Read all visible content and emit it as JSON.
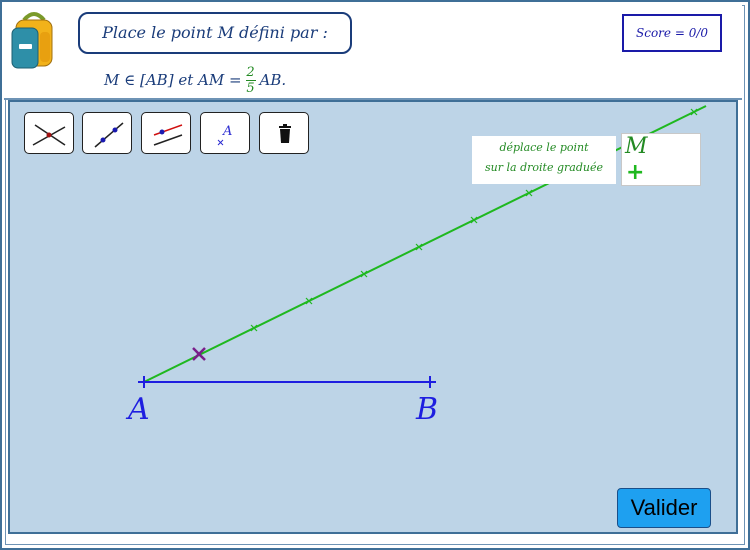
{
  "header": {
    "instruction": "Place le point M défini par :",
    "formula": {
      "prefix": "M ∈ [AB] et AM =",
      "numerator": "2",
      "denominator": "5",
      "suffix": "AB."
    },
    "score": "Score = 0/0"
  },
  "toolbar": {
    "tools": [
      {
        "name": "intersection-tool-icon"
      },
      {
        "name": "point-on-line-tool-icon"
      },
      {
        "name": "parallel-line-tool-icon"
      },
      {
        "name": "named-point-tool-icon",
        "label": "A"
      },
      {
        "name": "trash-icon"
      }
    ]
  },
  "hint": {
    "line1": "déplace le point",
    "line2": "sur la droite graduée"
  },
  "draggable_point": {
    "label": "M",
    "handle": "+"
  },
  "figure": {
    "point_a": "A",
    "point_b": "B",
    "graduation_count": 10
  },
  "colors": {
    "segment": "#1e1ee0",
    "graduated_line": "#1fb81f",
    "marked_point": "#7a1f8a",
    "accent_text": "#238a23",
    "button": "#1ea0f0"
  },
  "actions": {
    "validate": "Valider"
  }
}
